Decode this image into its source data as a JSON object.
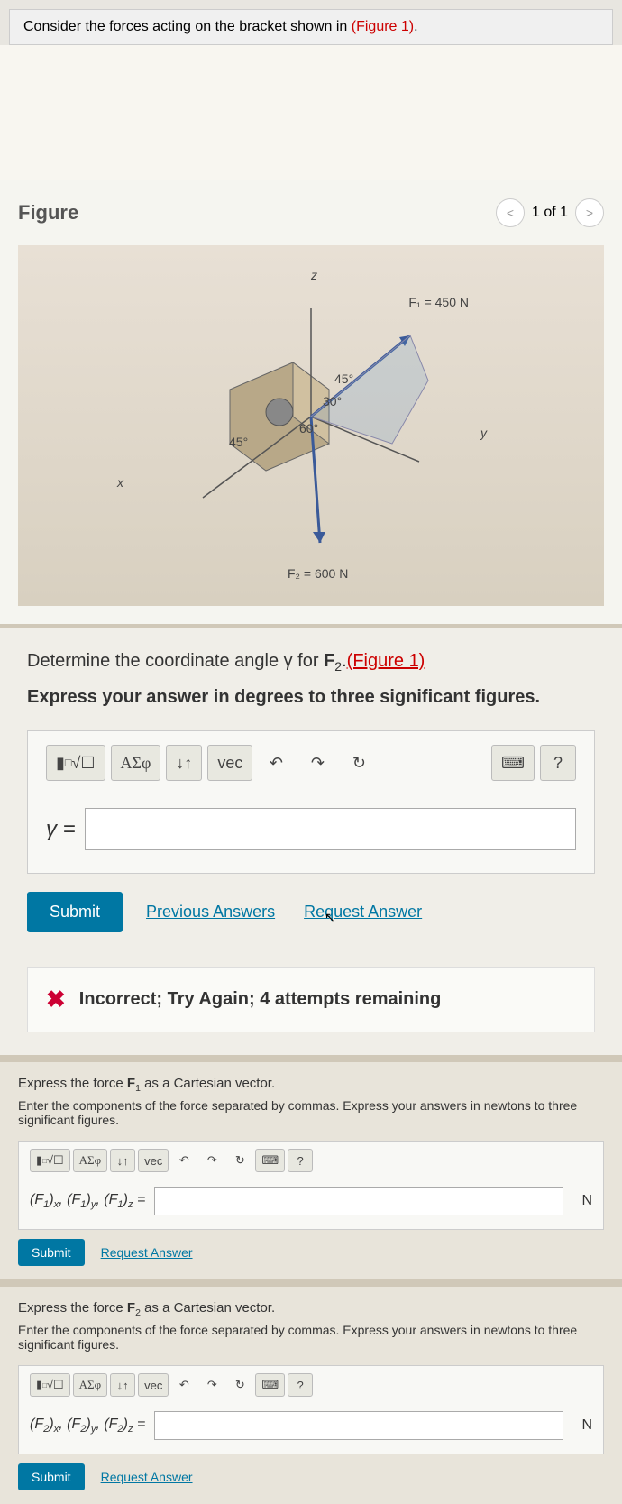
{
  "intro": {
    "text_before": "Consider the forces acting on the bracket shown in ",
    "link": "(Figure 1)",
    "text_after": "."
  },
  "figure": {
    "title": "Figure",
    "counter": "1 of 1",
    "f1_label": "F₁ = 450 N",
    "f2_label": "F₂ = 600 N",
    "angle_45a": "45°",
    "angle_30": "30°",
    "angle_60": "60°",
    "angle_45b": "45°",
    "axis_x": "x",
    "axis_y": "y",
    "axis_z": "z"
  },
  "partA": {
    "prompt_before": "Determine the coordinate angle γ for ",
    "prompt_bold": "F",
    "prompt_sub": "2",
    "prompt_after": ".",
    "prompt_link": "(Figure 1)",
    "instruction": "Express your answer in degrees to three significant figures.",
    "var_label": "γ =",
    "submit": "Submit",
    "prev_answers": "Previous Answers",
    "request_answer": "Request Answer",
    "feedback": "Incorrect; Try Again; 4 attempts remaining"
  },
  "partB": {
    "prompt_before": "Express the force ",
    "prompt_bold": "F",
    "prompt_sub": "1",
    "prompt_after": " as a Cartesian vector.",
    "instruction": "Enter the components of the force separated by commas. Express your answers in newtons to three significant figures.",
    "var_label": "(F₁)ₓ, (F₁)ᵧ, (F₁)_z =",
    "unit": "N",
    "submit": "Submit",
    "request_answer": "Request Answer"
  },
  "partC": {
    "prompt_before": "Express the force ",
    "prompt_bold": "F",
    "prompt_sub": "2",
    "prompt_after": " as a Cartesian vector.",
    "instruction": "Enter the components of the force separated by commas. Express your answers in newtons to three significant figures.",
    "var_label": "(F₂)ₓ, (F₂)ᵧ, (F₂)_z =",
    "unit": "N",
    "submit": "Submit",
    "request_answer": "Request Answer"
  },
  "toolbar": {
    "templates": "√☐",
    "greek": "ΑΣφ",
    "subscript": "↓↑",
    "vec": "vec",
    "undo": "↶",
    "redo": "↷",
    "reset": "↻",
    "keyboard": "⌨",
    "help": "?"
  }
}
